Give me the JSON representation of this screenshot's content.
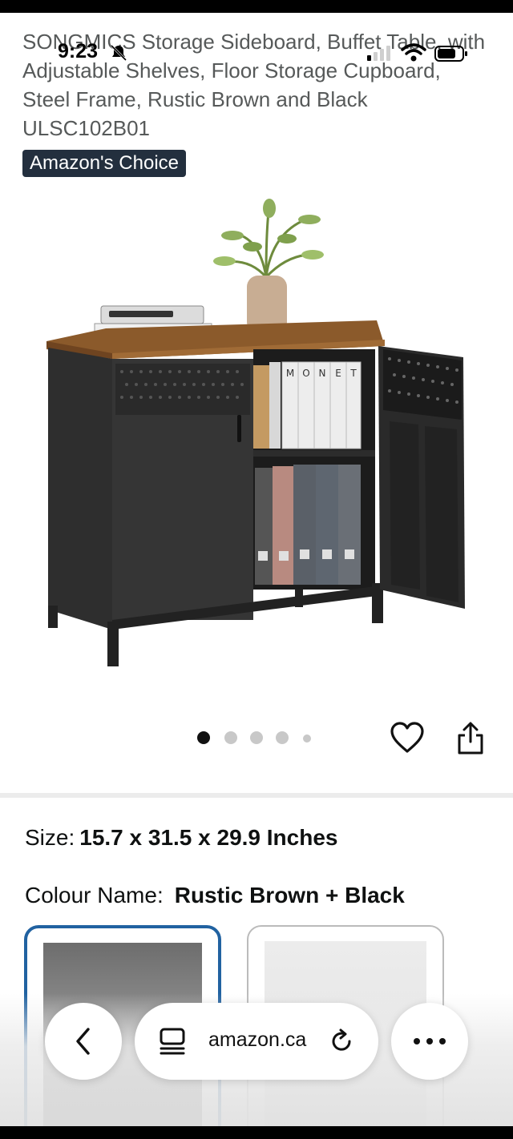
{
  "status_bar": {
    "time": "9:23"
  },
  "product": {
    "title": "SONGMICS Storage Sideboard, Buffet Table, with Adjustable Shelves, Floor Storage Cupboard, Steel Frame, Rustic Brown and Black ULSC102B01",
    "badge": "Amazon's Choice",
    "image_book_labels": [
      "M",
      "O",
      "N",
      "E",
      "T"
    ],
    "image_count": 5,
    "selected_image_index": 0
  },
  "options": {
    "size_label": "Size:",
    "size_value": "15.7 x 31.5 x 29.9 Inches",
    "colour_label": "Colour Name:",
    "colour_value": "Rustic Brown + Black"
  },
  "browser": {
    "url": "amazon.ca",
    "icons": [
      "chevron-left-icon",
      "tabs-icon",
      "reload-icon",
      "more-icon"
    ]
  },
  "colors": {
    "badge_bg": "#232f3e",
    "selected_swatch_border": "#2162a1",
    "wood": "#8b5a2b",
    "cabinet": "#2b2b2b"
  }
}
